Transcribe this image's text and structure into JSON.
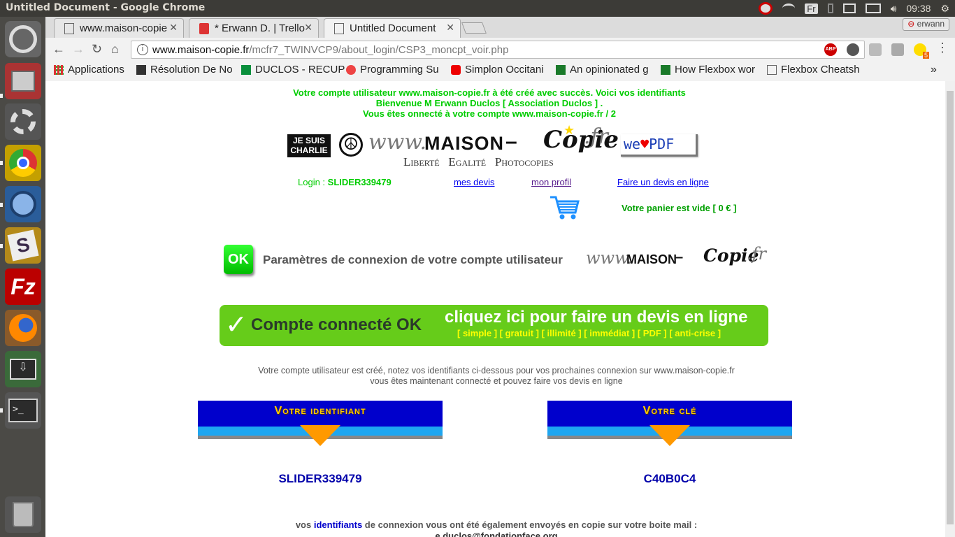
{
  "os": {
    "window_title": "Untitled Document - Google Chrome",
    "keyboard": "Fr",
    "time": "09:38"
  },
  "browser": {
    "tabs": [
      {
        "label": "www.maison-copie"
      },
      {
        "label": "* Erwann D. | Trello"
      },
      {
        "label": "Untitled Document"
      }
    ],
    "profile": "erwann",
    "url_domain": "www.maison-copie.fr",
    "url_path": "/mcfr7_TWINVCP9/about_login/CSP3_moncpt_voir.php",
    "bookmarks": [
      "Applications",
      "Résolution De No",
      "DUCLOS - RECUP",
      "Programming Su",
      "Simplon Occitani",
      "An opinionated g",
      "How Flexbox wor",
      "Flexbox Cheatsh"
    ],
    "more": "»",
    "ext_badge": "5",
    "abp": "ABP"
  },
  "page": {
    "header_line1": "Votre compte utilisateur www.maison-copie.fr à été créé avec succès. Voici vos identifiants",
    "header_line2": "Bienvenue M Erwann Duclos [ Association Duclos ] .",
    "header_line3": "Vous êtes onnecté à votre compte www.maison-copie.fr / 2",
    "charlie_1": "JE SUIS",
    "charlie_2": "CHARLIE",
    "logo_www": "www.",
    "logo_maison": "MAISON",
    "logo_dash": " – ",
    "logo_copie": "Copie",
    "logo_fr": ".fr",
    "logo_tagline": "Liberté   Egalité   Photocopies",
    "pdf_we": "we",
    "pdf_pdf": "PDF",
    "login_label": "Login : ",
    "login_value": "SLIDER339479",
    "nav_mes_devis": "mes devis",
    "nav_mon_profil": "mon profil",
    "nav_devis_ligne": "Faire un devis en ligne",
    "cart_text": "Votre panier est vide [ 0 € ]",
    "ok_badge": "OK",
    "params_title": "Paramètres de connexion de votre compte utilisateur",
    "logo2_www": "www.",
    "logo2_maison": "MAISON",
    "logo2_dash": " – ",
    "logo2_copie": "Copie",
    "logo2_fr": ".fr",
    "banner_check": "✓",
    "banner_left": "Compte connecté OK",
    "banner_right": "cliquez ici pour faire un devis en ligne",
    "banner_sub": "[ simple ] [ gratuit ] [ illimité ] [ immédiat ] [ PDF ] [ anti-crise ]",
    "info_line1": "Votre compte utilisateur est créé, notez vos identifiants ci-dessous pour vos prochaines connexion sur www.maison-copie.fr",
    "info_line2": "vous êtes maintenant connecté et pouvez faire vos devis en ligne",
    "box1_title": "Votre identifiant",
    "box1_value": "SLIDER339479",
    "box2_title": "Votre clé",
    "box2_value": "C40B0C4",
    "footer_a": "vos ",
    "footer_b": "identifiants",
    "footer_c": " de connexion vous ont été également envoyés en copie sur votre boite mail :",
    "footer_email": "e.duclos@fondationface.org"
  }
}
